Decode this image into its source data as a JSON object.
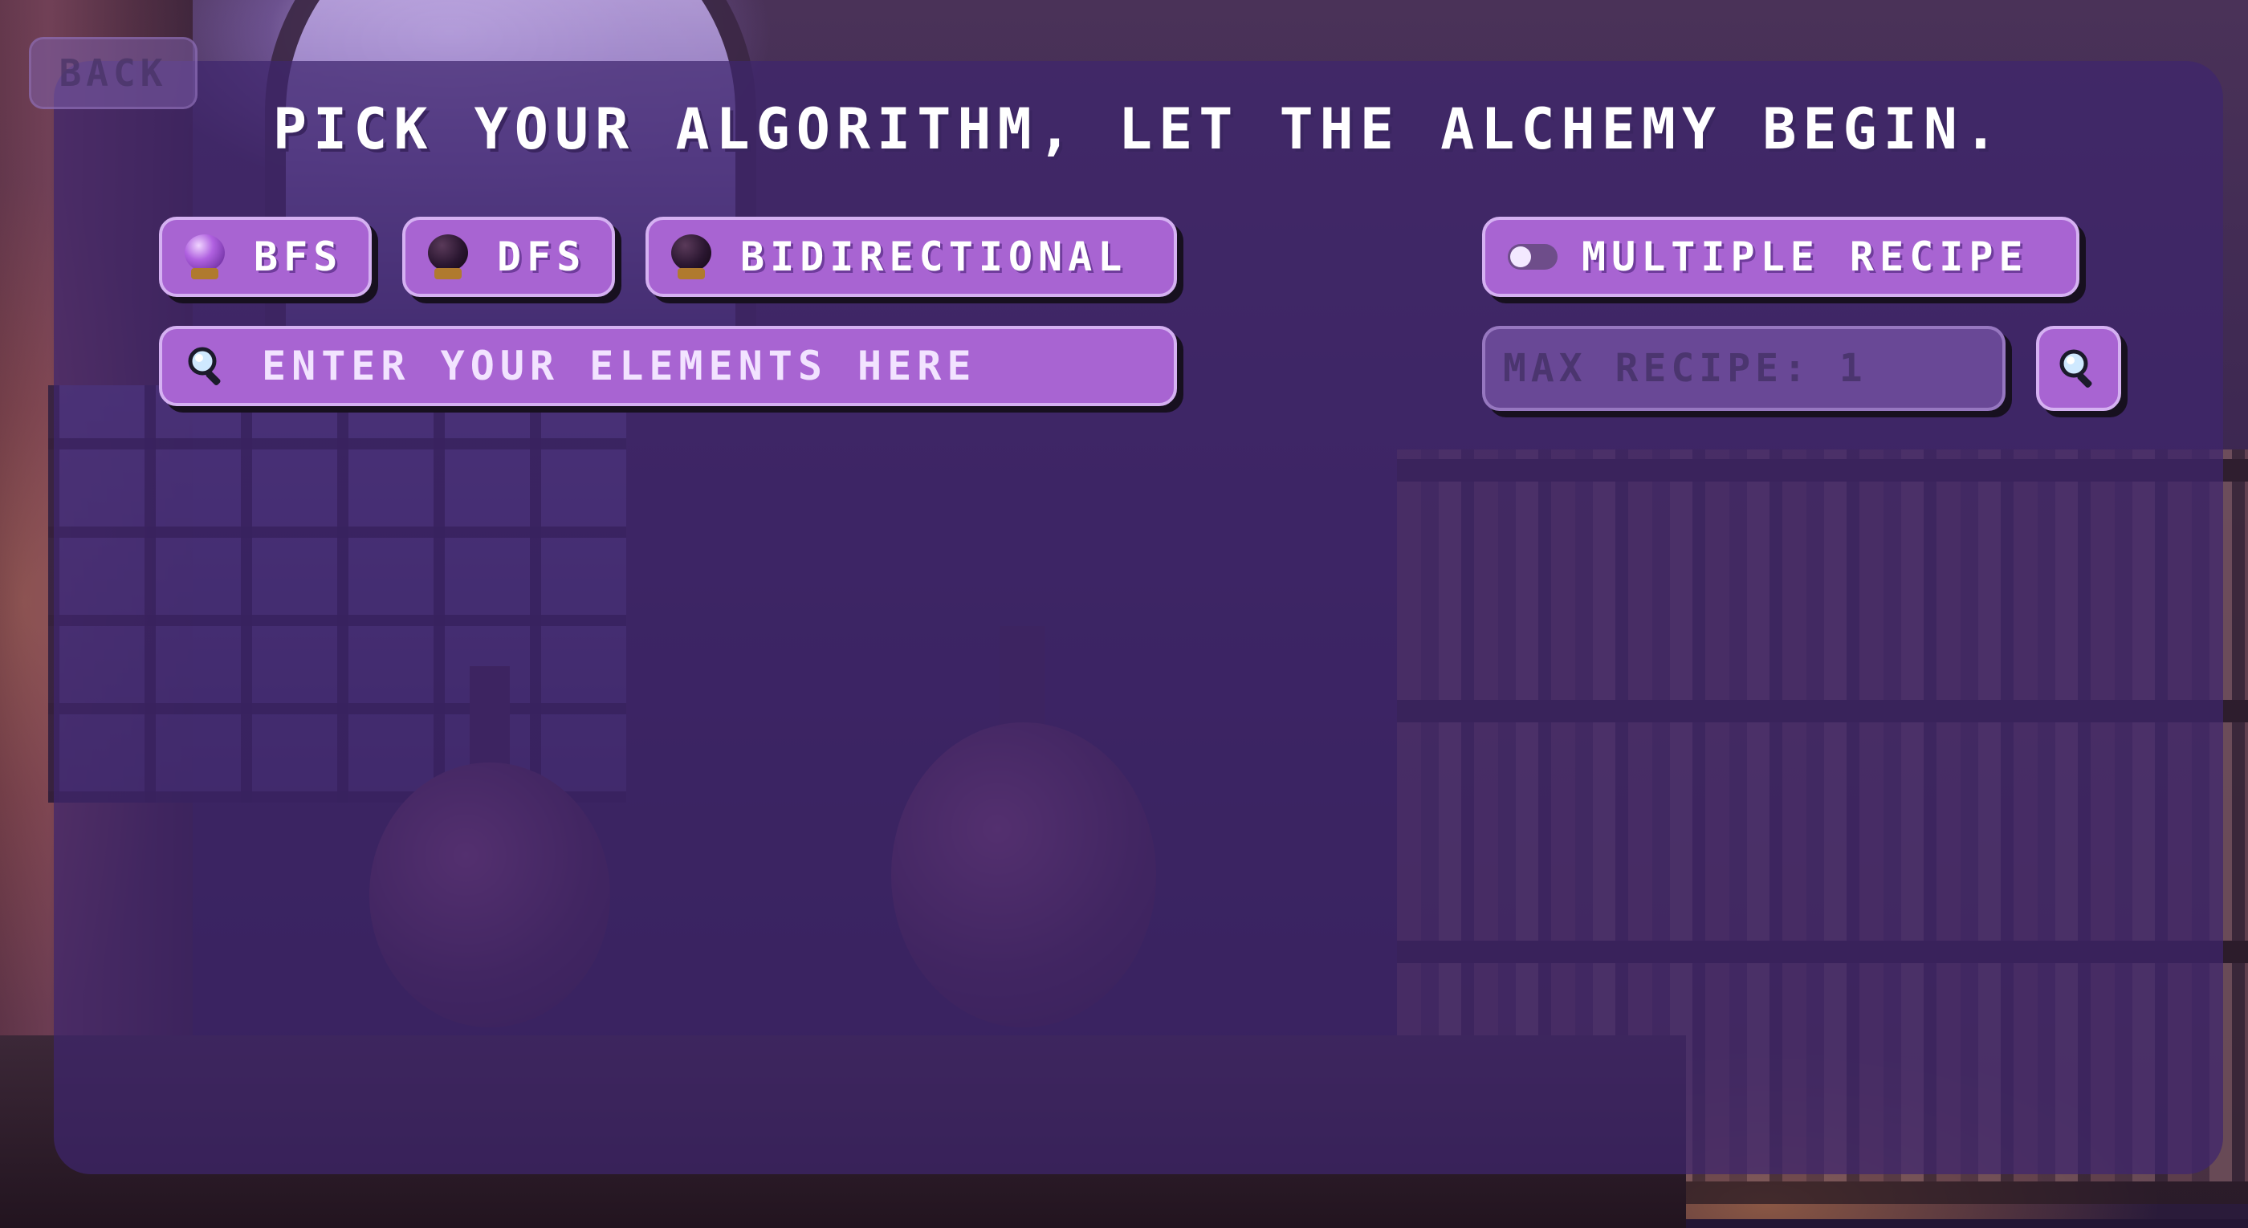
{
  "header": {
    "back_label": "BACK",
    "title": "PICK YOUR ALGORITHM, LET THE ALCHEMY BEGIN."
  },
  "algorithms": [
    {
      "label": "BFS",
      "selected": true
    },
    {
      "label": "DFS",
      "selected": false
    },
    {
      "label": "BIDIRECTIONAL",
      "selected": false
    }
  ],
  "multiple_recipe": {
    "label": "MULTIPLE RECIPE",
    "enabled": false
  },
  "search": {
    "placeholder": "ENTER YOUR ELEMENTS HERE",
    "value": "",
    "icon": "search-icon"
  },
  "max_recipe": {
    "placeholder": "MAX RECIPE: 1",
    "value": ""
  },
  "colors": {
    "accent": "#a864d2",
    "panel": "#3e266e",
    "text": "#ffffff"
  }
}
